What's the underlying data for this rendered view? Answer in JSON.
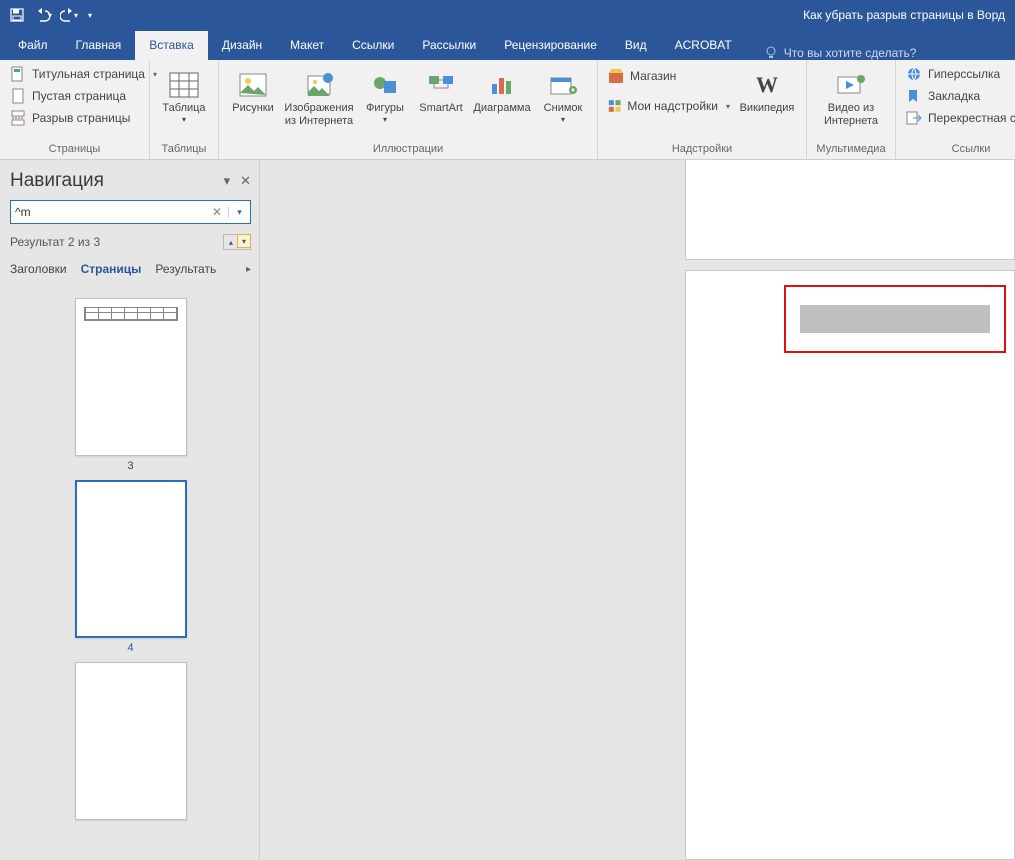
{
  "titlebar": {
    "doc_title": "Как убрать разрыв страницы в Ворд"
  },
  "tabs": {
    "file": "Файл",
    "home": "Главная",
    "insert": "Вставка",
    "design": "Дизайн",
    "layout": "Макет",
    "references": "Ссылки",
    "mailings": "Рассылки",
    "review": "Рецензирование",
    "view": "Вид",
    "acrobat": "ACROBAT",
    "tell_me": "Что вы хотите сделать?"
  },
  "ribbon": {
    "pages": {
      "cover_page": "Титульная страница",
      "blank_page": "Пустая страница",
      "page_break": "Разрыв страницы",
      "label": "Страницы"
    },
    "tables": {
      "table": "Таблица",
      "label": "Таблицы"
    },
    "illustrations": {
      "pictures": "Рисунки",
      "online_pics_l1": "Изображения",
      "online_pics_l2": "из Интернета",
      "shapes": "Фигуры",
      "smartart": "SmartArt",
      "chart": "Диаграмма",
      "screenshot": "Снимок",
      "label": "Иллюстрации"
    },
    "addins": {
      "store": "Магазин",
      "my_addins": "Мои надстройки",
      "wikipedia": "Википедия",
      "label": "Надстройки"
    },
    "media": {
      "video_l1": "Видео из",
      "video_l2": "Интернета",
      "label": "Мультимедиа"
    },
    "links": {
      "hyperlink": "Гиперссылка",
      "bookmark": "Закладка",
      "crossref": "Перекрестная ссылка",
      "label": "Ссылки"
    }
  },
  "nav": {
    "title": "Навигация",
    "search_value": "^m",
    "result": "Результат 2 из 3",
    "tab_headings": "Заголовки",
    "tab_pages": "Страницы",
    "tab_results": "Результать",
    "thumbs": [
      {
        "num": "3",
        "selected": false,
        "has_table": true
      },
      {
        "num": "4",
        "selected": true,
        "has_table": false
      },
      {
        "num": "",
        "selected": false,
        "has_table": false
      }
    ]
  }
}
